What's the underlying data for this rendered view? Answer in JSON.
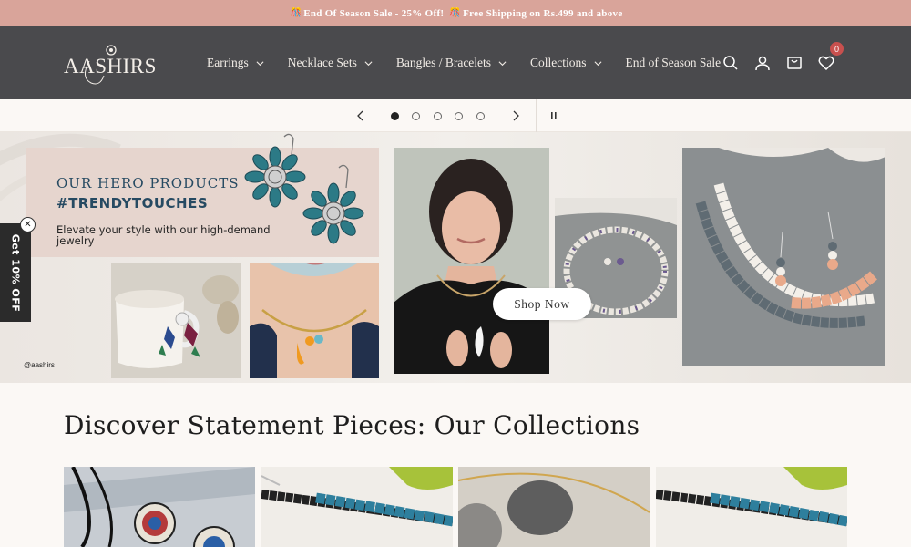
{
  "announcement": {
    "text_part1": "End Of Season Sale - 25% Off!",
    "text_part2": "Free Shipping on Rs.499 and above",
    "emoji": "🎊"
  },
  "header": {
    "logo_text": "AASHIRS",
    "nav": [
      {
        "label": "Earrings",
        "has_dropdown": true
      },
      {
        "label": "Necklace Sets",
        "has_dropdown": true
      },
      {
        "label": "Bangles / Bracelets",
        "has_dropdown": true
      },
      {
        "label": "Collections",
        "has_dropdown": true
      },
      {
        "label": "End of Season Sale",
        "has_dropdown": false
      }
    ],
    "icons": [
      "search-icon",
      "account-icon",
      "cart-icon",
      "wishlist-icon"
    ],
    "wishlist_count": "0"
  },
  "slideshow": {
    "dots": 5,
    "active_dot": 1
  },
  "hero": {
    "title": "OUR HERO PRODUCTS",
    "hashtag": "#TRENDYTOUCHES",
    "tagline": "Elevate your style with our high-demand jewelry",
    "cta": "Shop Now",
    "handle": "@aashirs"
  },
  "side_tab": {
    "label": "Get 10% OFF",
    "close": "✕"
  },
  "collections": {
    "title": "Discover Statement Pieces: Our Collections"
  },
  "colors": {
    "announcement_bg": "#d9a49a",
    "header_bg": "#4a4a4d",
    "page_bg": "#fbf8f5",
    "hero_card_bg": "#e6d5ce",
    "brand_blue": "#264a62",
    "badge": "#c8504e"
  }
}
